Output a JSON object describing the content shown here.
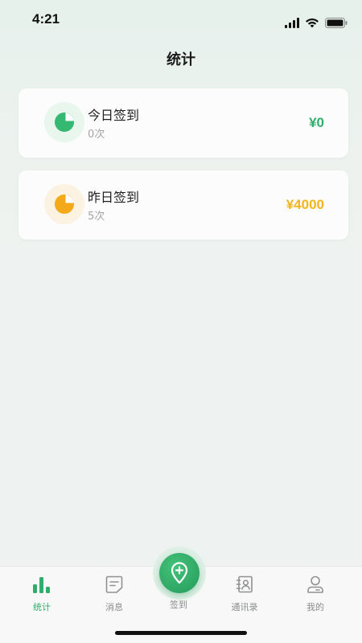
{
  "status_bar": {
    "time": "4:21"
  },
  "header": {
    "title": "统计"
  },
  "cards": {
    "today": {
      "title": "今日签到",
      "count": "0次",
      "amount": "¥0",
      "icon": "pie-chart-icon",
      "accent": "#2fae6b"
    },
    "yesterday": {
      "title": "昨日签到",
      "count": "5次",
      "amount": "¥4000",
      "icon": "pie-chart-icon",
      "accent": "#f3b51b"
    }
  },
  "tabs": {
    "stats": {
      "label": "统计",
      "icon": "bar-chart-icon",
      "active": true
    },
    "messages": {
      "label": "消息",
      "icon": "message-icon"
    },
    "checkin": {
      "label": "签到",
      "icon": "location-pin-plus-icon"
    },
    "contacts": {
      "label": "通讯录",
      "icon": "contacts-icon"
    },
    "mine": {
      "label": "我的",
      "icon": "user-icon"
    }
  },
  "colors": {
    "primary_green": "#2fae6b",
    "amber": "#f3b51b"
  }
}
